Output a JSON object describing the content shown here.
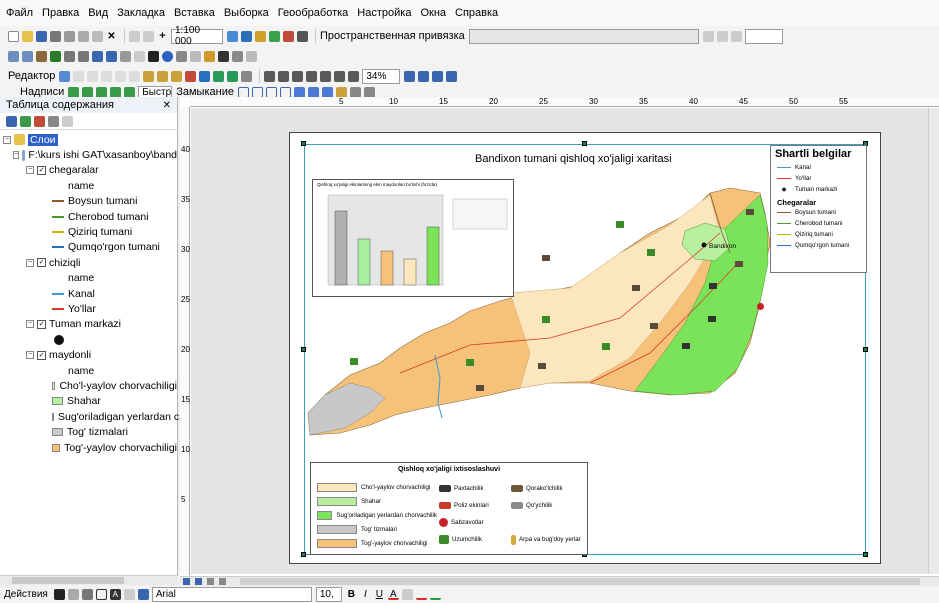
{
  "menu": [
    "Файл",
    "Правка",
    "Вид",
    "Закладка",
    "Вставка",
    "Выборка",
    "Геообработка",
    "Настройка",
    "Окна",
    "Справка"
  ],
  "toolbar": {
    "scale": "1:100 000",
    "snap_label": "Пространственная привязка",
    "editor_label": "Редактор",
    "zoom_value": "34%",
    "labels_label": "Надписи",
    "fast_label": "Быстр",
    "closure_label": "Замыкание"
  },
  "toc": {
    "title": "Таблица содержания",
    "root": "Слои",
    "path": "F:\\kurs ishi GAT\\xasanboy\\band",
    "layers": [
      {
        "name": "chegaralar",
        "field": "name",
        "items": [
          {
            "label": "Boysun tumani",
            "color": "#8b5a2b"
          },
          {
            "label": "Cherobod tumani",
            "color": "#4a9a2a"
          },
          {
            "label": "Qiziriq tumani",
            "color": "#c8b400"
          },
          {
            "label": "Qumqo'rgon tumani",
            "color": "#1f6fbf"
          }
        ]
      },
      {
        "name": "chiziqli",
        "field": "name",
        "items": [
          {
            "label": "Kanal",
            "color": "#3a9ad9"
          },
          {
            "label": "Yo'llar",
            "color": "#d83a2a"
          }
        ]
      },
      {
        "name": "Tuman markazi"
      },
      {
        "name": "maydonli",
        "field": "name",
        "items": [
          {
            "label": "Cho'l-yaylov chorvachiligi",
            "color": "#fbe6bd"
          },
          {
            "label": "Shahar",
            "color": "#b8f0a0"
          },
          {
            "label": "Sug'oriladigan yerlardan c",
            "color": "#7be35a"
          },
          {
            "label": "Tog' tizmalari",
            "color": "#c8c8c8"
          },
          {
            "label": "Tog'-yaylov chorvachiligi",
            "color": "#f6c27a"
          }
        ]
      }
    ]
  },
  "map": {
    "title": "Bandixon tumani qishloq xo'jaligi xaritasi",
    "city": "Bandixon",
    "legend_title": "Shartli belgilar",
    "legend_items": [
      {
        "label": "Kanal",
        "color": "#3a9ad9"
      },
      {
        "label": "Yo'llar",
        "color": "#d83a2a"
      },
      {
        "label": "Tuman markazi",
        "color": "#111111"
      }
    ],
    "borders_title": "Chegaralar",
    "borders": [
      {
        "label": "Boysun tumani",
        "color": "#8b5a2b"
      },
      {
        "label": "Cherobod tumani",
        "color": "#4a9a2a"
      },
      {
        "label": "Qiziriq tumani",
        "color": "#c8b400"
      },
      {
        "label": "Qumqo'rgon tumani",
        "color": "#1f6fbf"
      }
    ],
    "spec_title": "Qishloq xo'jaligi ixtisoslashuvi",
    "spec": [
      {
        "label": "Cho'l-yaylov chorvachiligi",
        "color": "#fbe6bd"
      },
      {
        "label": "Shahar",
        "color": "#b8f0a0"
      },
      {
        "label": "Sug'oriladigan yerlardan chorvachilik",
        "color": "#7be35a"
      },
      {
        "label": "Tog' tizmalari",
        "color": "#c8c8c8"
      },
      {
        "label": "Tog'-yaylov chorvachiligi",
        "color": "#f6c27a"
      }
    ],
    "spec_icons": [
      "Paxtachilik",
      "Qorako'lchilik",
      "Poliz ekinlari",
      "Qo'ychilik",
      "Sabzavotlar",
      "Uzumchilik",
      "Arpa va bug'doy yerlar"
    ],
    "chart_title": "Qishloq xo'jaligi ekinlarining ekin maydonlari bo'lishi (fo'izda)"
  },
  "ruler_h": [
    "5",
    "10",
    "15",
    "20",
    "25",
    "30",
    "35",
    "40",
    "45",
    "50",
    "55"
  ],
  "ruler_v": [
    "40",
    "35",
    "30",
    "25",
    "20",
    "15",
    "10",
    "5"
  ],
  "status": {
    "actions": "Действия",
    "font": "Arial",
    "size": "10,"
  }
}
